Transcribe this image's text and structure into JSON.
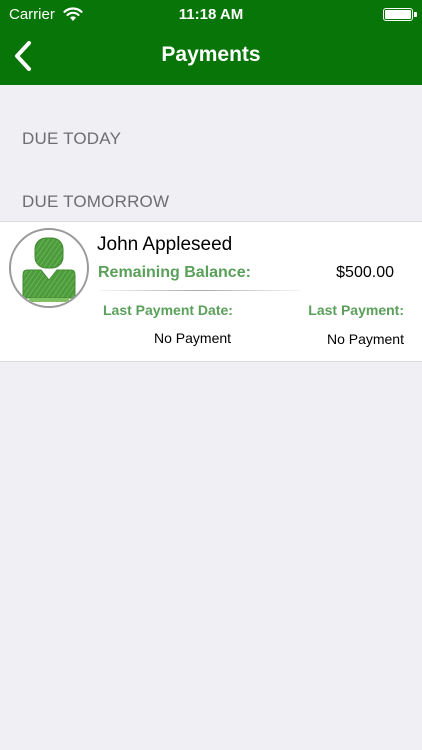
{
  "status_bar": {
    "carrier": "Carrier",
    "time": "11:18 AM",
    "wifi_icon": "wifi-icon",
    "battery_icon": "battery-icon",
    "battery_level": 1.0
  },
  "nav": {
    "title": "Payments",
    "back_icon": "chevron-left-icon",
    "bar_color": "#077507"
  },
  "sections": {
    "due_today": "DUE TODAY",
    "due_tomorrow": "DUE TOMORROW"
  },
  "payment_card": {
    "avatar_icon": "person-icon",
    "name": "John Appleseed",
    "remaining_balance_label": "Remaining Balance:",
    "remaining_balance_value": "$500.00",
    "last_payment_date_label": "Last Payment Date:",
    "last_payment_date_value": "No Payment",
    "last_payment_label": "Last Payment:",
    "last_payment_value": "No Payment",
    "accent_color": "#5aa05a"
  }
}
